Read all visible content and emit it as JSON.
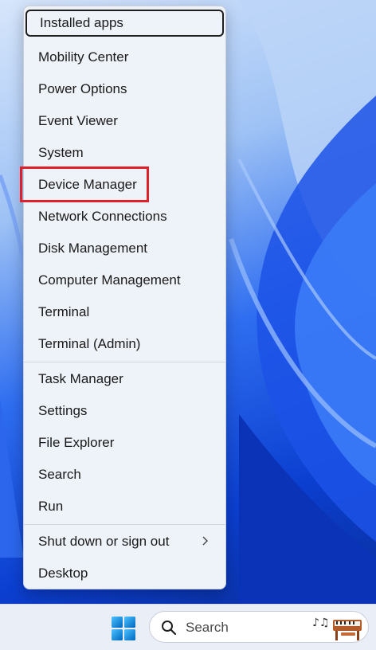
{
  "menu": {
    "items": [
      {
        "label": "Installed apps",
        "focused": true
      },
      {
        "label": "Mobility Center"
      },
      {
        "label": "Power Options"
      },
      {
        "label": "Event Viewer"
      },
      {
        "label": "System"
      },
      {
        "label": "Device Manager",
        "highlighted": true
      },
      {
        "label": "Network Connections"
      },
      {
        "label": "Disk Management"
      },
      {
        "label": "Computer Management"
      },
      {
        "label": "Terminal"
      },
      {
        "label": "Terminal (Admin)"
      },
      {
        "label": "Task Manager"
      },
      {
        "label": "Settings"
      },
      {
        "label": "File Explorer"
      },
      {
        "label": "Search"
      },
      {
        "label": "Run"
      },
      {
        "label": "Shut down or sign out",
        "has_submenu": true
      },
      {
        "label": "Desktop"
      }
    ]
  },
  "annotation": {
    "color": "#e0202a"
  },
  "taskbar": {
    "search_placeholder": "Search",
    "icons": [
      "windows-start-icon",
      "search-icon",
      "piano-music-search-highlight-icon"
    ]
  },
  "colors": {
    "accent": "#0b3fd0",
    "menu_bg": "#eef2f9"
  }
}
